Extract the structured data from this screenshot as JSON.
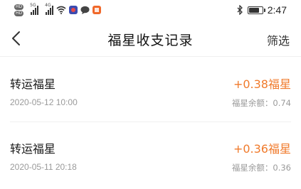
{
  "status_bar": {
    "hd_badges": [
      "HD",
      "HD"
    ],
    "network_labels": [
      "5G",
      "4G"
    ],
    "time": "2:47",
    "battery_level": 0.85,
    "icons": [
      "hd-icon",
      "signal-icon",
      "wifi-icon",
      "app-notification-icon",
      "chat-bubble-icon",
      "app-icon",
      "bluetooth-icon",
      "battery-icon"
    ]
  },
  "nav": {
    "title": "福星收支记录",
    "action_label": "筛选",
    "back_icon": "chevron-left-icon"
  },
  "records": [
    {
      "title": "转运福星",
      "time": "2020-05-12 10:00",
      "amount": "+0.38福星",
      "balance": "福星余额：0.74"
    },
    {
      "title": "转运福星",
      "time": "2020-05-11 20:18",
      "amount": "+0.36福星",
      "balance": "福星余额：0.36"
    }
  ],
  "colors": {
    "accent": "#f07a2b",
    "secondary_text": "#9a9a9a",
    "primary_text": "#1a1a1a"
  }
}
